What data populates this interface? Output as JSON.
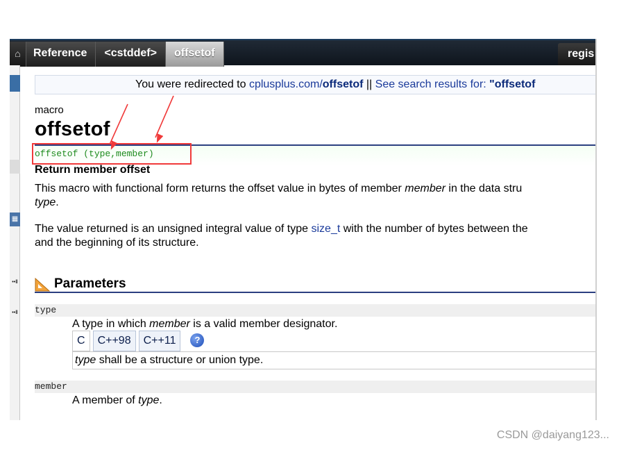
{
  "nav": {
    "home_icon": "home-icon",
    "breadcrumbs": [
      "Reference",
      "<cstddef>",
      "offsetof"
    ],
    "register_label": "regis"
  },
  "redirect": {
    "prefix": "You were redirected to ",
    "link_host": "cplusplus.com/",
    "link_page": "offsetof",
    "separator": " || ",
    "search_text": "See search results for: ",
    "search_term": "\"offsetof"
  },
  "page": {
    "kind": "macro",
    "title": "offsetof",
    "prototype": "offsetof (type,member)",
    "subtitle": "Return member offset",
    "para1_a": "This macro with functional form returns the offset value in bytes of member ",
    "para1_em": "member",
    "para1_b": " in the data stru",
    "para1_line2_em": "type",
    "para1_line2_end": ".",
    "para2_a": "The value returned is an unsigned integral value of type ",
    "para2_link": "size_t",
    "para2_b": " with the number of bytes between the",
    "para2_line2": "and the beginning of its structure."
  },
  "parameters": {
    "heading": "Parameters",
    "type_name": "type",
    "type_desc_a": "A type in which ",
    "type_desc_em": "member",
    "type_desc_b": " is a valid member designator.",
    "tabs": [
      "C",
      "C++98",
      "C++11"
    ],
    "help_icon": "?",
    "tab_panel_em": "type",
    "tab_panel_rest": " shall be a structure or union type.",
    "member_name": "member",
    "member_desc_a": "A member of ",
    "member_desc_em": "type",
    "member_desc_b": "."
  },
  "watermark": "CSDN @daiyang123...",
  "colors": {
    "nav_bg": "#141a22",
    "link": "#1a3a9a",
    "prototype_green": "#1e8a1e",
    "annotation_red": "#f03a3a",
    "rule_blue": "#2b3f80"
  }
}
